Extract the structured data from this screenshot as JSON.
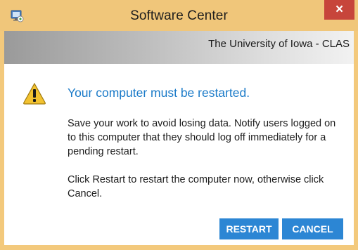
{
  "window": {
    "title": "Software Center",
    "close_label": "×"
  },
  "banner": {
    "org": "The University of Iowa - CLAS"
  },
  "message": {
    "heading": "Your computer must be restarted.",
    "paragraph1": "Save your work to avoid losing data. Notify users logged on to this computer that they should log off immediately for a pending restart.",
    "paragraph2": "Click Restart to restart the computer now, otherwise click Cancel."
  },
  "buttons": {
    "restart": "RESTART",
    "cancel": "CANCEL"
  },
  "icons": {
    "app": "software-center-icon",
    "warning": "warning-icon"
  },
  "colors": {
    "titlebar": "#f0c67a",
    "close": "#c7453b",
    "heading": "#1a7ac8",
    "button": "#2c86d4"
  }
}
